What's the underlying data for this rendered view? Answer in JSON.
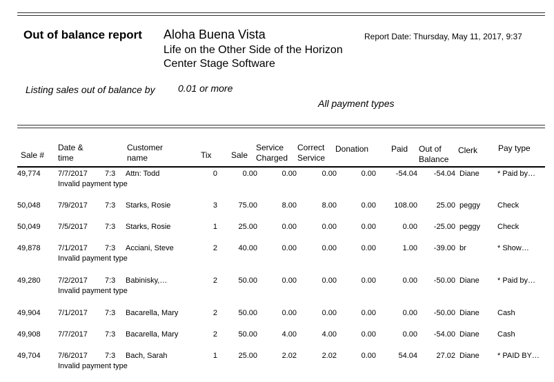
{
  "report": {
    "title": "Out of balance report",
    "org_line1": "Aloha Buena Vista",
    "org_line2": "Life on the Other Side of the Horizon",
    "org_line3": "Center Stage Software",
    "report_date": "Report Date: Thursday, May 11, 2017, 9:37",
    "listing_text": "Listing sales out of balance by",
    "threshold": "0.01 or more",
    "payment_types": "All payment types"
  },
  "columns": {
    "sale_no": "Sale #",
    "date_time_1": "Date &",
    "date_time_2": "time",
    "customer_1": "Customer",
    "customer_2": "name",
    "tix": "Tix",
    "sale": "Sale",
    "service_1": "Service",
    "service_2": "Charged",
    "correct_1": "Correct",
    "correct_2": "Service",
    "donation": "Donation",
    "paid": "Paid",
    "oob_1": "Out of",
    "oob_2": "Balance",
    "clerk": "Clerk",
    "pay_type": "Pay type"
  },
  "rows": [
    {
      "sale_no": "49,774",
      "date": "7/7/2017",
      "time": "7:3",
      "customer": "Attn: Todd",
      "tix": "0",
      "sale": "0.00",
      "service": "0.00",
      "correct": "0.00",
      "donation": "0.00",
      "paid": "-54.04",
      "oob": "-54.04",
      "clerk": "Diane",
      "pay_type": "* Paid by…",
      "note": "Invalid payment type"
    },
    {
      "sale_no": "50,048",
      "date": "7/9/2017",
      "time": "7:3",
      "customer": "Starks, Rosie",
      "tix": "3",
      "sale": "75.00",
      "service": "8.00",
      "correct": "8.00",
      "donation": "0.00",
      "paid": "108.00",
      "oob": "25.00",
      "clerk": "peggy",
      "pay_type": "Check",
      "note": ""
    },
    {
      "sale_no": "50,049",
      "date": "7/5/2017",
      "time": "7:3",
      "customer": "Starks, Rosie",
      "tix": "1",
      "sale": "25.00",
      "service": "0.00",
      "correct": "0.00",
      "donation": "0.00",
      "paid": "0.00",
      "oob": "-25.00",
      "clerk": "peggy",
      "pay_type": "Check",
      "note": ""
    },
    {
      "sale_no": "49,878",
      "date": "7/1/2017",
      "time": "7:3",
      "customer": "Acciani, Steve",
      "tix": "2",
      "sale": "40.00",
      "service": "0.00",
      "correct": "0.00",
      "donation": "0.00",
      "paid": "1.00",
      "oob": "-39.00",
      "clerk": "br",
      "pay_type": "* Show…",
      "note": "Invalid payment type"
    },
    {
      "sale_no": "49,280",
      "date": "7/2/2017",
      "time": "7:3",
      "customer": "Babinisky,…",
      "tix": "2",
      "sale": "50.00",
      "service": "0.00",
      "correct": "0.00",
      "donation": "0.00",
      "paid": "0.00",
      "oob": "-50.00",
      "clerk": "Diane",
      "pay_type": "* Paid by…",
      "note": "Invalid payment type"
    },
    {
      "sale_no": "49,904",
      "date": "7/1/2017",
      "time": "7:3",
      "customer": "Bacarella, Mary",
      "tix": "2",
      "sale": "50.00",
      "service": "0.00",
      "correct": "0.00",
      "donation": "0.00",
      "paid": "0.00",
      "oob": "-50.00",
      "clerk": "Diane",
      "pay_type": "Cash",
      "note": ""
    },
    {
      "sale_no": "49,908",
      "date": "7/7/2017",
      "time": "7:3",
      "customer": "Bacarella, Mary",
      "tix": "2",
      "sale": "50.00",
      "service": "4.00",
      "correct": "4.00",
      "donation": "0.00",
      "paid": "0.00",
      "oob": "-54.00",
      "clerk": "Diane",
      "pay_type": "Cash",
      "note": ""
    },
    {
      "sale_no": "49,704",
      "date": "7/6/2017",
      "time": "7:3",
      "customer": "Bach, Sarah",
      "tix": "1",
      "sale": "25.00",
      "service": "2.02",
      "correct": "2.02",
      "donation": "0.00",
      "paid": "54.04",
      "oob": "27.02",
      "clerk": "Diane",
      "pay_type": "* PAID BY…",
      "note": "Invalid payment type"
    }
  ]
}
